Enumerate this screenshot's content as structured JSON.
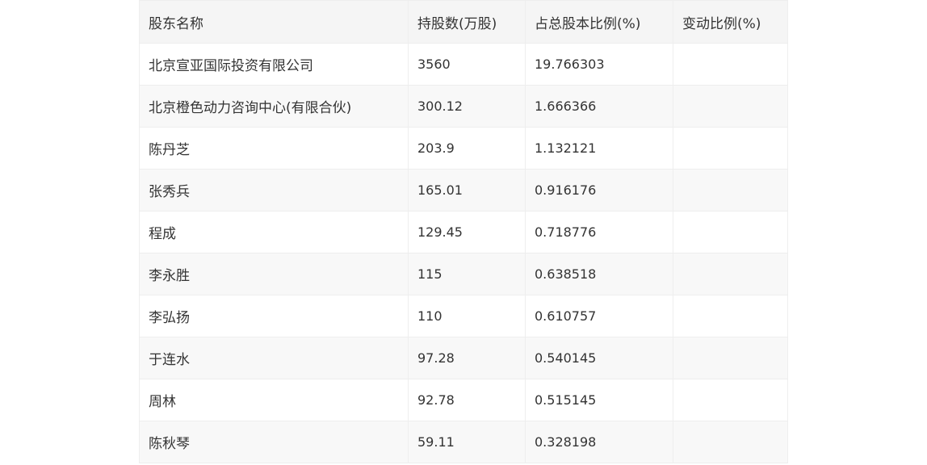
{
  "table": {
    "headers": [
      "股东名称",
      "持股数(万股)",
      "占总股本比例(%)",
      "变动比例(%)"
    ],
    "rows": [
      [
        "北京宣亚国际投资有限公司",
        "3560",
        "19.766303",
        ""
      ],
      [
        "北京橙色动力咨询中心(有限合伙)",
        "300.12",
        "1.666366",
        ""
      ],
      [
        "陈丹芝",
        "203.9",
        "1.132121",
        ""
      ],
      [
        "张秀兵",
        "165.01",
        "0.916176",
        ""
      ],
      [
        "程成",
        "129.45",
        "0.718776",
        ""
      ],
      [
        "李永胜",
        "115",
        "0.638518",
        ""
      ],
      [
        "李弘扬",
        "110",
        "0.610757",
        ""
      ],
      [
        "于连水",
        "97.28",
        "0.540145",
        ""
      ],
      [
        "周林",
        "92.78",
        "0.515145",
        ""
      ],
      [
        "陈秋琴",
        "59.11",
        "0.328198",
        ""
      ]
    ]
  }
}
